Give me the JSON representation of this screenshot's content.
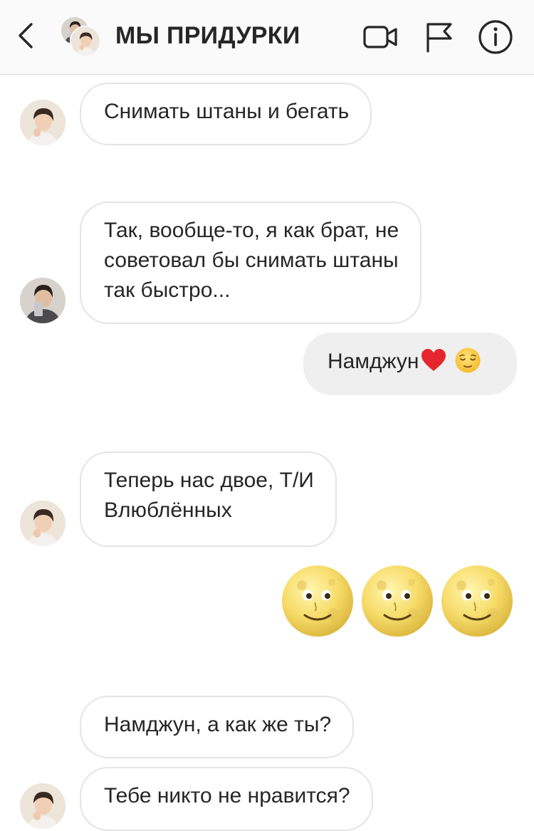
{
  "header": {
    "title": "МЫ ПРИДУРКИ",
    "icons": [
      "back-chevron-icon",
      "video-camera-icon",
      "flag-icon",
      "info-icon"
    ]
  },
  "messages": [
    {
      "direction": "incoming",
      "avatar": "jin",
      "lines": [
        "Снимать штаны и бегать"
      ]
    },
    {
      "direction": "incoming",
      "avatar": "namjoon",
      "lines": [
        "Так, вообще-то, я как брат, не",
        "советовал бы снимать штаны",
        "так быстро..."
      ]
    },
    {
      "direction": "outgoing",
      "text": "Намджун",
      "emojis": [
        "red-heart",
        "relieved-face"
      ]
    },
    {
      "direction": "incoming",
      "avatar": "jin",
      "lines": [
        "Теперь нас двое, Т/И",
        "Влюблённых"
      ]
    },
    {
      "direction": "outgoing",
      "emojis": [
        "full-moon-face",
        "full-moon-face",
        "full-moon-face"
      ]
    },
    {
      "direction": "incoming",
      "lines": [
        "Намджун, а как же ты?"
      ]
    },
    {
      "direction": "incoming",
      "avatar": "jin",
      "lines": [
        "Тебе никто не нравится?"
      ]
    }
  ],
  "colors": {
    "header_bg": "#fafafa",
    "incoming_border": "#e4e4e4",
    "outgoing_bg": "#efefef",
    "text": "#262626"
  }
}
